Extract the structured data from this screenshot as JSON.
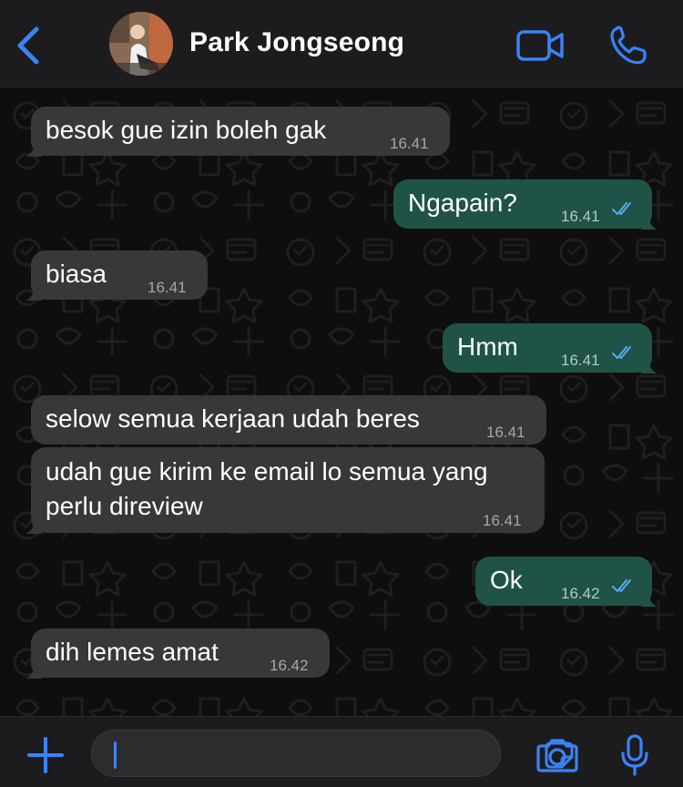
{
  "header": {
    "contact_name": "Park Jongseong"
  },
  "messages": [
    {
      "direction": "in",
      "lines": [
        "besok gue izin boleh gak"
      ],
      "time": "16.41"
    },
    {
      "direction": "out",
      "lines": [
        "Ngapain?"
      ],
      "time": "16.41",
      "status": "read"
    },
    {
      "direction": "in",
      "lines": [
        "biasa"
      ],
      "time": "16.41"
    },
    {
      "direction": "out",
      "lines": [
        "Hmm"
      ],
      "time": "16.41",
      "status": "read"
    },
    {
      "direction": "in",
      "lines": [
        "selow semua kerjaan udah beres"
      ],
      "time": "16.41"
    },
    {
      "direction": "in",
      "lines": [
        "udah gue kirim ke email lo semua yang",
        "perlu direview"
      ],
      "time": "16.41"
    },
    {
      "direction": "out",
      "lines": [
        "Ok"
      ],
      "time": "16.42",
      "status": "read"
    },
    {
      "direction": "in",
      "lines": [
        "dih lemes amat"
      ],
      "time": "16.42"
    }
  ],
  "composer": {
    "value": ""
  },
  "icons": {
    "back": "chevron-left-icon",
    "video": "video-camera-icon",
    "call": "phone-icon",
    "plus": "plus-icon",
    "sticker": "sticker-icon",
    "camera": "camera-icon",
    "mic": "microphone-icon",
    "read_receipt": "double-check-icon"
  },
  "colors": {
    "accent": "#3b82f6",
    "incoming_bubble": "#38383a",
    "outgoing_bubble": "#1f5348",
    "header_bg": "#1c1c1e",
    "chat_bg": "#0e0e0e"
  }
}
